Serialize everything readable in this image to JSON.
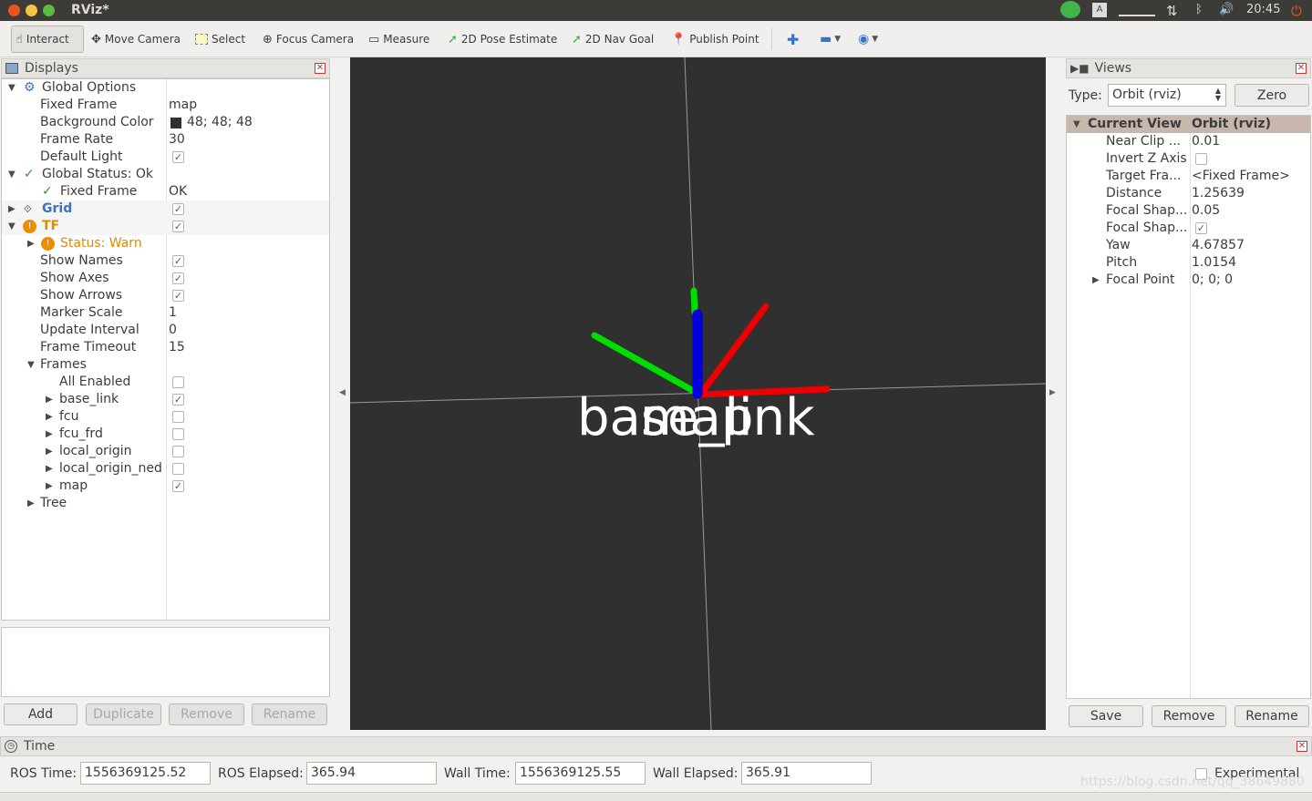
{
  "window": {
    "title": "RViz*",
    "clock": "20:45"
  },
  "toolbar": {
    "interact": "Interact",
    "move_camera": "Move Camera",
    "select": "Select",
    "focus_camera": "Focus Camera",
    "measure": "Measure",
    "pose_estimate": "2D Pose Estimate",
    "nav_goal": "2D Nav Goal",
    "publish_point": "Publish Point"
  },
  "displays": {
    "title": "Displays",
    "rows": [
      {
        "label": "Global Options",
        "value": ""
      },
      {
        "label": "Fixed Frame",
        "value": "map"
      },
      {
        "label": "Background Color",
        "value": "48; 48; 48"
      },
      {
        "label": "Frame Rate",
        "value": "30"
      },
      {
        "label": "Default Light",
        "value": ""
      },
      {
        "label": "Global Status: Ok",
        "value": ""
      },
      {
        "label": "Fixed Frame",
        "value": "OK"
      },
      {
        "label": "Grid",
        "value": ""
      },
      {
        "label": "TF",
        "value": ""
      },
      {
        "label": "Status: Warn",
        "value": ""
      },
      {
        "label": "Show Names",
        "value": ""
      },
      {
        "label": "Show Axes",
        "value": ""
      },
      {
        "label": "Show Arrows",
        "value": ""
      },
      {
        "label": "Marker Scale",
        "value": "1"
      },
      {
        "label": "Update Interval",
        "value": "0"
      },
      {
        "label": "Frame Timeout",
        "value": "15"
      },
      {
        "label": "Frames",
        "value": ""
      },
      {
        "label": "All Enabled",
        "value": ""
      },
      {
        "label": "base_link",
        "value": ""
      },
      {
        "label": "fcu",
        "value": ""
      },
      {
        "label": "fcu_frd",
        "value": ""
      },
      {
        "label": "local_origin",
        "value": ""
      },
      {
        "label": "local_origin_ned",
        "value": ""
      },
      {
        "label": "map",
        "value": ""
      },
      {
        "label": "Tree",
        "value": ""
      }
    ],
    "buttons": {
      "add": "Add",
      "duplicate": "Duplicate",
      "remove": "Remove",
      "rename": "Rename"
    }
  },
  "viewport": {
    "frame_labels": [
      "base_link",
      "map"
    ],
    "colors": {
      "x": "#ff0000",
      "y": "#00cc00",
      "z": "#0000ff",
      "background": "#303030"
    }
  },
  "views": {
    "title": "Views",
    "type_label": "Type:",
    "type_value": "Orbit (rviz)",
    "zero_button": "Zero",
    "header": {
      "key": "Current View",
      "value": "Orbit (rviz)"
    },
    "rows": [
      {
        "label": "Near Clip ...",
        "value": "0.01"
      },
      {
        "label": "Invert Z Axis",
        "value": ""
      },
      {
        "label": "Target Fra...",
        "value": "<Fixed Frame>"
      },
      {
        "label": "Distance",
        "value": "1.25639"
      },
      {
        "label": "Focal Shap...",
        "value": "0.05"
      },
      {
        "label": "Focal Shap...",
        "value": ""
      },
      {
        "label": "Yaw",
        "value": "4.67857"
      },
      {
        "label": "Pitch",
        "value": "1.0154"
      },
      {
        "label": "Focal Point",
        "value": "0; 0; 0"
      }
    ],
    "buttons": {
      "save": "Save",
      "remove": "Remove",
      "rename": "Rename"
    }
  },
  "time": {
    "title": "Time",
    "ros_time_label": "ROS Time:",
    "ros_time": "1556369125.52",
    "ros_elapsed_label": "ROS Elapsed:",
    "ros_elapsed": "365.94",
    "wall_time_label": "Wall Time:",
    "wall_time": "1556369125.55",
    "wall_elapsed_label": "Wall Elapsed:",
    "wall_elapsed": "365.91",
    "experimental": "Experimental"
  },
  "watermark": "https://blog.csdn.net/qq_38649880"
}
